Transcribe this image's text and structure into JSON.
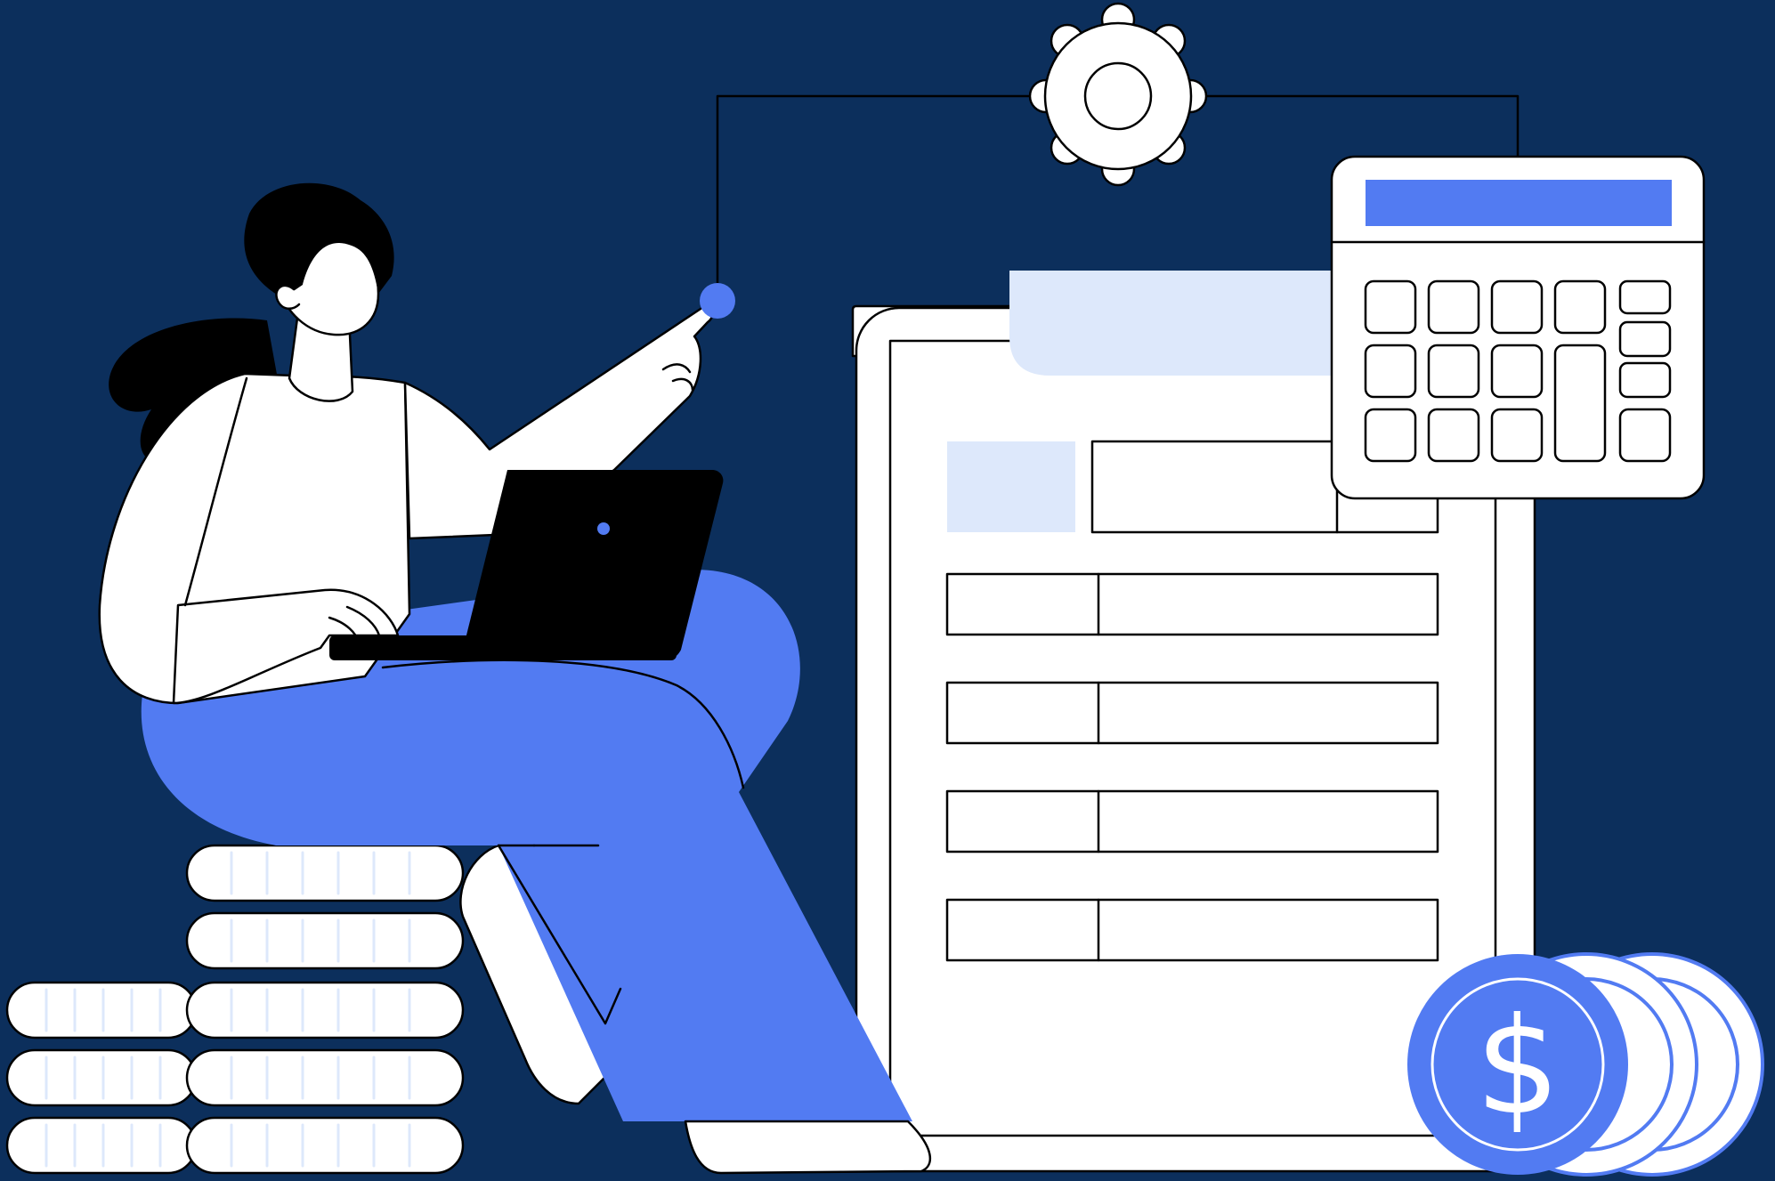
{
  "colors": {
    "background": "#0c2f5c",
    "accent_blue": "#527bf2",
    "light_blue": "#dde8fb",
    "outline": "#000000",
    "white": "#ffffff",
    "laptop": "#000000"
  },
  "coin_symbol": "$",
  "icons": [
    "gear-icon",
    "calculator-icon",
    "document-icon",
    "laptop-icon",
    "coin-icon",
    "coin-stack-icon"
  ]
}
